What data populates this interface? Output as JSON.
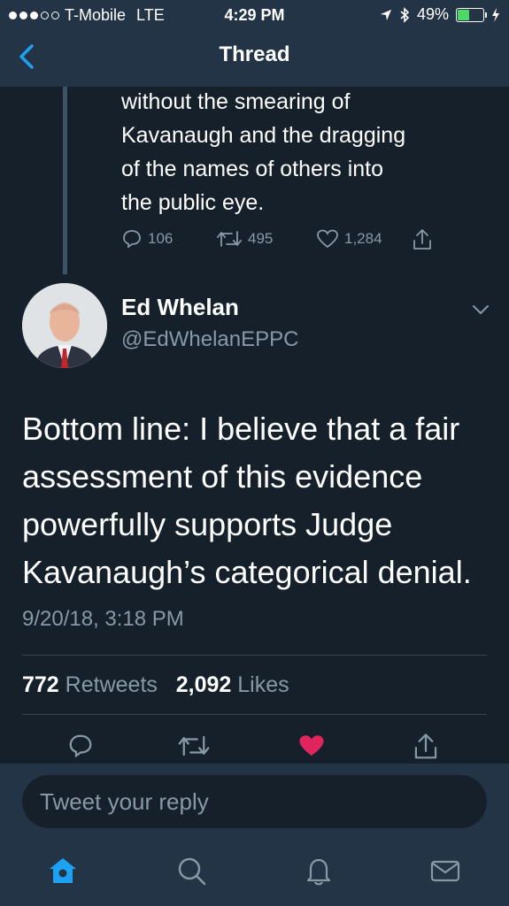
{
  "status_bar": {
    "carrier": "T-Mobile",
    "network": "LTE",
    "time": "4:29 PM",
    "battery": "49%",
    "battery_level": 0.49
  },
  "header": {
    "title": "Thread"
  },
  "previous_tweet": {
    "text_lines": [
      "without the smearing of",
      "Kavanaugh and the dragging",
      "of the names of others into",
      "the public eye."
    ],
    "replies": "106",
    "retweets": "495",
    "likes": "1,284"
  },
  "tweet": {
    "author_name": "Ed Whelan",
    "author_handle": "@EdWhelanEPPC",
    "text_lines": [
      "Bottom line: I believe that a fair",
      "assessment of this evidence",
      "powerfully supports Judge",
      "Kavanaugh’s categorical denial."
    ],
    "datetime": "9/20/18, 3:18 PM",
    "retweet_count": "772",
    "retweets_label": "Retweets",
    "like_count": "2,092",
    "likes_label": "Likes",
    "liked": true
  },
  "reply": {
    "placeholder": "Tweet your reply"
  },
  "tabs": [
    "home-icon",
    "search-icon",
    "notifications-icon",
    "messages-icon"
  ],
  "colors": {
    "background": "#15202b",
    "bar": "#243447",
    "accent": "#1da1f2",
    "secondary_text": "#8899a6",
    "like": "#e0245e"
  }
}
